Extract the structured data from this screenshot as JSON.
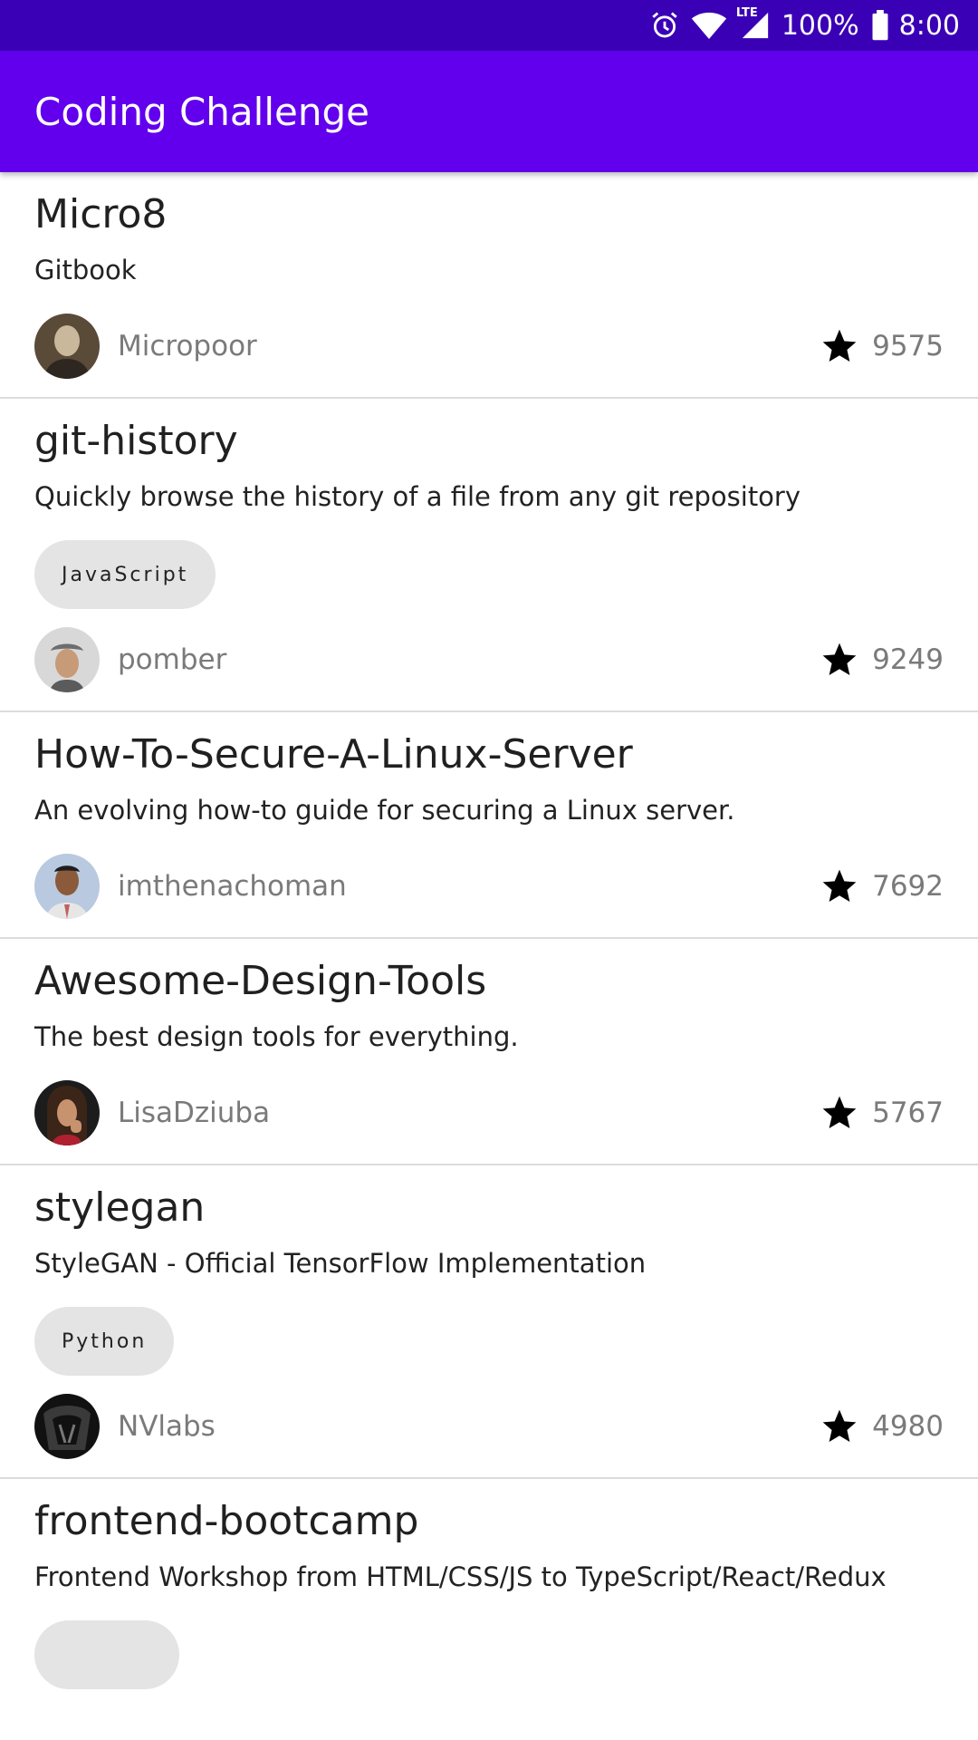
{
  "status_bar": {
    "battery_text": "100%",
    "time": "8:00",
    "network_label": "LTE",
    "icons": [
      "alarm-icon",
      "wifi-icon",
      "cell-signal-icon",
      "battery-icon"
    ]
  },
  "app_bar": {
    "title": "Coding Challenge",
    "color": "#6200ee"
  },
  "repos": [
    {
      "name": "Micro8",
      "description": "Gitbook",
      "language": "",
      "owner": "Micropoor",
      "stars": "9575"
    },
    {
      "name": "git-history",
      "description": "Quickly browse the history of a file from any git repository",
      "language": "JavaScript",
      "owner": "pomber",
      "stars": "9249"
    },
    {
      "name": "How-To-Secure-A-Linux-Server",
      "description": "An evolving how-to guide for securing a Linux server.",
      "language": "",
      "owner": "imthenachoman",
      "stars": "7692"
    },
    {
      "name": "Awesome-Design-Tools",
      "description": "The best design tools for everything.",
      "language": "",
      "owner": "LisaDziuba",
      "stars": "5767"
    },
    {
      "name": "stylegan",
      "description": "StyleGAN - Official TensorFlow Implementation",
      "language": "Python",
      "owner": "NVlabs",
      "stars": "4980"
    },
    {
      "name": "frontend-bootcamp",
      "description": "Frontend Workshop from HTML/CSS/JS to TypeScript/React/Redux",
      "language": "",
      "owner": "",
      "stars": ""
    }
  ]
}
